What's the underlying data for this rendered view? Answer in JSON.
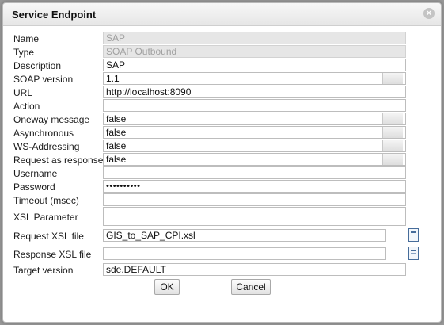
{
  "dialog": {
    "title": "Service Endpoint",
    "close_icon": "close-circle-icon"
  },
  "fields": {
    "name": {
      "label": "Name",
      "value": "SAP"
    },
    "type": {
      "label": "Type",
      "value": "SOAP Outbound"
    },
    "description": {
      "label": "Description",
      "value": "SAP"
    },
    "soap_version": {
      "label": "SOAP version",
      "value": "1.1"
    },
    "url": {
      "label": "URL",
      "value": "http://localhost:8090"
    },
    "action": {
      "label": "Action",
      "value": ""
    },
    "oneway_message": {
      "label": "Oneway message",
      "value": "false"
    },
    "asynchronous": {
      "label": "Asynchronous",
      "value": "false"
    },
    "ws_addressing": {
      "label": "WS-Addressing",
      "value": "false"
    },
    "request_as_response": {
      "label": "Request as response",
      "value": "false"
    },
    "username": {
      "label": "Username",
      "value": ""
    },
    "password": {
      "label": "Password",
      "value": "••••••••••"
    },
    "timeout": {
      "label": "Timeout (msec)",
      "value": ""
    },
    "xsl_parameter": {
      "label": "XSL Parameter",
      "value": ""
    },
    "request_xsl": {
      "label": "Request XSL file",
      "value": "GIS_to_SAP_CPI.xsl"
    },
    "response_xsl": {
      "label": "Response XSL file",
      "value": ""
    },
    "target_version": {
      "label": "Target version",
      "value": "sde.DEFAULT"
    }
  },
  "buttons": {
    "ok": "OK",
    "cancel": "Cancel"
  }
}
